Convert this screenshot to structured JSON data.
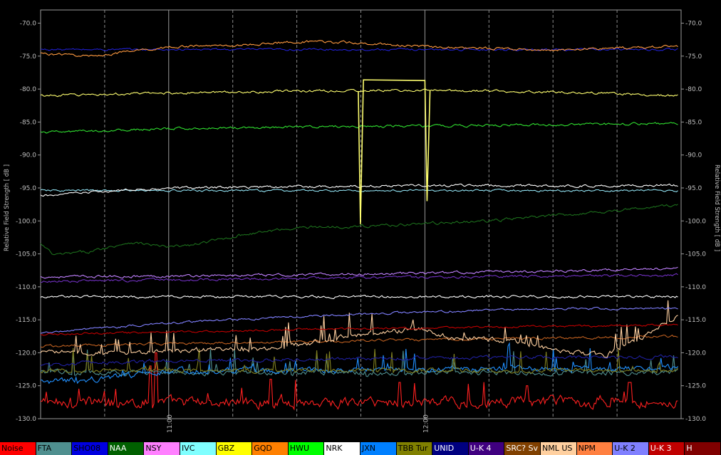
{
  "chart_data": {
    "type": "line",
    "ylabel": "Relative Field Strength  [ dB ]",
    "ylim": [
      -130,
      -68
    ],
    "xlim": [
      10.5,
      13.0
    ],
    "y_ticks": [
      "-70.0",
      "-75.0",
      "-80.0",
      "-85.0",
      "-90.0",
      "-95.0",
      "-100.0",
      "-105.0",
      "-110.0",
      "-115.0",
      "-120.0",
      "-125.0",
      "-130.0"
    ],
    "x_tick_labels": [
      {
        "x": 11.0,
        "label": "11:00"
      },
      {
        "x": 12.0,
        "label": "12:00"
      }
    ],
    "series": [
      {
        "name": "Noise",
        "color": "#ff2020",
        "base": -127.5,
        "noise": 1.3,
        "spikes": [
          [
            10.93,
            -122
          ],
          [
            10.95,
            -120
          ],
          [
            11.4,
            -124
          ],
          [
            11.9,
            -124.5
          ],
          [
            12.4,
            -125
          ],
          [
            12.8,
            -124.5
          ]
        ]
      },
      {
        "name": "FTA",
        "color": "#4f8f8f",
        "base": -123,
        "noise": 0.6
      },
      {
        "name": "SHO08",
        "color": "#2020d0",
        "base": -74.0,
        "noise": 0.25
      },
      {
        "name": "NAA",
        "color": "#1c6e1c",
        "base": -102,
        "noise": 0.35,
        "points": [
          [
            10.5,
            -103.5
          ],
          [
            10.55,
            -105.2
          ],
          [
            10.7,
            -104.6
          ],
          [
            10.85,
            -103.2
          ],
          [
            11.0,
            -104.0
          ],
          [
            11.1,
            -103.6
          ],
          [
            11.3,
            -102.0
          ],
          [
            11.5,
            -101.0
          ],
          [
            11.75,
            -100.8
          ],
          [
            12.0,
            -100.4
          ],
          [
            12.25,
            -100.0
          ],
          [
            12.5,
            -99.2
          ],
          [
            12.75,
            -98.4
          ],
          [
            12.98,
            -97.6
          ]
        ]
      },
      {
        "name": "NSY",
        "color": "#c080ff",
        "base": -108.3,
        "noise": 0.3,
        "points": [
          [
            10.5,
            -108.5
          ],
          [
            11.5,
            -108.2
          ],
          [
            12.5,
            -107.6
          ],
          [
            12.98,
            -107.2
          ]
        ]
      },
      {
        "name": "IVC",
        "color": "#90e0f0",
        "base": -95.4,
        "noise": 0.25
      },
      {
        "name": "GBZ",
        "color": "#ffff70",
        "base": -80.5,
        "noise": 0.3,
        "points": [
          [
            10.5,
            -81.0
          ],
          [
            11.0,
            -80.6
          ],
          [
            11.5,
            -80.3
          ],
          [
            12.0,
            -80.2
          ],
          [
            12.5,
            -80.4
          ],
          [
            12.98,
            -81.0
          ]
        ]
      },
      {
        "name": "GQD",
        "color": "#ff9a40",
        "base": -74.5,
        "noise": 0.3,
        "points": [
          [
            10.5,
            -74.6
          ],
          [
            10.7,
            -75.0
          ],
          [
            10.85,
            -74.3
          ],
          [
            11.0,
            -73.6
          ],
          [
            11.3,
            -73.3
          ],
          [
            11.5,
            -72.8
          ],
          [
            11.75,
            -73.0
          ],
          [
            12.0,
            -73.6
          ],
          [
            12.25,
            -73.8
          ],
          [
            12.5,
            -74.1
          ],
          [
            12.98,
            -73.5
          ]
        ]
      },
      {
        "name": "HWU",
        "color": "#30e030",
        "base": -86,
        "noise": 0.3,
        "points": [
          [
            10.5,
            -86.6
          ],
          [
            11.0,
            -86.0
          ],
          [
            11.5,
            -85.7
          ],
          [
            12.0,
            -85.6
          ],
          [
            12.5,
            -85.4
          ],
          [
            12.98,
            -85.2
          ]
        ]
      },
      {
        "name": "NRK",
        "color": "#ffffff",
        "base": -95,
        "noise": 0.3,
        "points": [
          [
            10.5,
            -96.2
          ],
          [
            10.8,
            -95.4
          ],
          [
            11.0,
            -95.0
          ],
          [
            11.5,
            -94.8
          ],
          [
            12.0,
            -94.6
          ],
          [
            12.5,
            -94.7
          ],
          [
            12.98,
            -94.6
          ]
        ]
      },
      {
        "name": "JXN",
        "color": "#2090ff",
        "base": -122.5,
        "noise": 0.7,
        "points": [
          [
            10.5,
            -124.5
          ],
          [
            10.7,
            -124.0
          ],
          [
            10.9,
            -123.3
          ],
          [
            11.0,
            -122.8
          ],
          [
            12.98,
            -122.3
          ]
        ]
      },
      {
        "name": "TBB Tur",
        "color": "#808020",
        "base": -122.7,
        "noise": 0.5
      },
      {
        "name": "UNID",
        "color": "#2020a0",
        "base": -121,
        "noise": 0.4,
        "points": [
          [
            10.5,
            -121.8
          ],
          [
            11.0,
            -121.2
          ],
          [
            12.0,
            -120.8
          ],
          [
            12.98,
            -120.6
          ]
        ]
      },
      {
        "name": "U-K 4",
        "color": "#7030c0",
        "base": -109,
        "noise": 0.3,
        "points": [
          [
            10.5,
            -109.2
          ],
          [
            11.5,
            -108.7
          ],
          [
            12.98,
            -108.2
          ]
        ]
      },
      {
        "name": "SRC? Sv",
        "color": "#c06020",
        "base": -118.5,
        "noise": 0.3,
        "points": [
          [
            10.5,
            -119.0
          ],
          [
            11.0,
            -118.6
          ],
          [
            12.0,
            -118.0
          ],
          [
            12.98,
            -117.5
          ]
        ]
      },
      {
        "name": "NML US",
        "color": "#ffd0a0",
        "base": -119.5,
        "noise": 0.6,
        "points": [
          [
            10.5,
            -119.8
          ],
          [
            10.7,
            -120.0
          ],
          [
            11.0,
            -119.8
          ],
          [
            11.2,
            -119.5
          ],
          [
            11.45,
            -119.5
          ],
          [
            11.5,
            -118.8
          ],
          [
            11.75,
            -117.2
          ],
          [
            12.0,
            -116.3
          ],
          [
            12.1,
            -117.8
          ],
          [
            12.2,
            -117.8
          ],
          [
            12.35,
            -118.3
          ],
          [
            12.5,
            -119.5
          ],
          [
            12.7,
            -120.5
          ],
          [
            12.85,
            -117.5
          ],
          [
            12.98,
            -114.6
          ]
        ]
      },
      {
        "name": "NPM",
        "color": "#ffffff",
        "base": -111.5,
        "noise": 0.3
      },
      {
        "name": "U-K 2",
        "color": "#8080ff",
        "base": -115,
        "noise": 0.25,
        "points": [
          [
            10.5,
            -117.0
          ],
          [
            11.0,
            -115.5
          ],
          [
            11.5,
            -114.5
          ],
          [
            12.0,
            -113.8
          ],
          [
            12.5,
            -113.3
          ],
          [
            12.98,
            -113.3
          ]
        ]
      },
      {
        "name": "U-K 3",
        "color": "#c00000",
        "base": -116.3,
        "noise": 0.25,
        "points": [
          [
            10.5,
            -117.2
          ],
          [
            11.5,
            -116.5
          ],
          [
            12.5,
            -116.0
          ],
          [
            12.98,
            -115.8
          ]
        ]
      }
    ]
  },
  "legend": [
    {
      "label": "Noise",
      "bg": "#ff0000",
      "fg": "#000000"
    },
    {
      "label": "FTA",
      "bg": "#4f8f8f",
      "fg": "#000000"
    },
    {
      "label": "SHO08",
      "bg": "#0000e0",
      "fg": "#000000"
    },
    {
      "label": "NAA",
      "bg": "#006000",
      "fg": "#ffffff"
    },
    {
      "label": "NSY",
      "bg": "#ff80ff",
      "fg": "#000000"
    },
    {
      "label": "IVC",
      "bg": "#80ffff",
      "fg": "#000000"
    },
    {
      "label": "GBZ",
      "bg": "#ffff00",
      "fg": "#000000"
    },
    {
      "label": "GQD",
      "bg": "#ff8000",
      "fg": "#000000"
    },
    {
      "label": "HWU",
      "bg": "#00ff00",
      "fg": "#000000"
    },
    {
      "label": "NRK",
      "bg": "#ffffff",
      "fg": "#000000"
    },
    {
      "label": "JXN",
      "bg": "#0080ff",
      "fg": "#000000"
    },
    {
      "label": "TBB Tur",
      "bg": "#808000",
      "fg": "#000000"
    },
    {
      "label": "UNID",
      "bg": "#000080",
      "fg": "#ffffff"
    },
    {
      "label": "U-K 4",
      "bg": "#400080",
      "fg": "#ffffff"
    },
    {
      "label": "SRC? Sv",
      "bg": "#804000",
      "fg": "#ffffff"
    },
    {
      "label": "NML US",
      "bg": "#ffd0a0",
      "fg": "#000000"
    },
    {
      "label": "NPM",
      "bg": "#ff8040",
      "fg": "#000000"
    },
    {
      "label": "U-K 2",
      "bg": "#8080ff",
      "fg": "#000000"
    },
    {
      "label": "U-K 3",
      "bg": "#c00000",
      "fg": "#ffffff"
    },
    {
      "label": "H",
      "bg": "#800000",
      "fg": "#ffffff"
    }
  ]
}
